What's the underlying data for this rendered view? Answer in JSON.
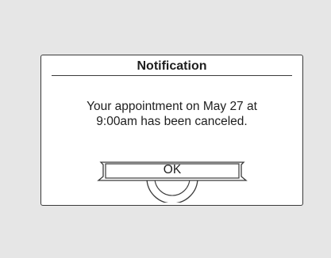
{
  "dialog": {
    "title": "Notification",
    "message_line1": "Your appointment on May 27 at",
    "message_line2": "9:00am has been canceled.",
    "ok_label": "OK"
  }
}
